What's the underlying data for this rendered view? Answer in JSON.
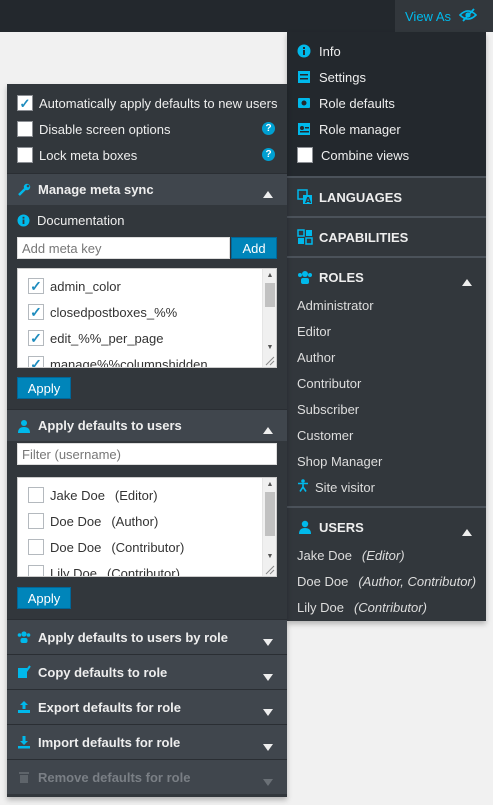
{
  "topbar": {
    "view_as": "View As"
  },
  "dropdown": {
    "items": [
      {
        "label": "Info"
      },
      {
        "label": "Settings"
      },
      {
        "label": "Role defaults"
      },
      {
        "label": "Role manager"
      },
      {
        "label": "Combine views"
      }
    ],
    "languages": "LANGUAGES",
    "capabilities": "CAPABILITIES",
    "roles_title": "ROLES",
    "roles": [
      "Administrator",
      "Editor",
      "Author",
      "Contributor",
      "Subscriber",
      "Customer",
      "Shop Manager"
    ],
    "site_visitor": "Site visitor",
    "users_title": "USERS",
    "users": [
      {
        "name": "Jake Doe",
        "role": "(Editor)"
      },
      {
        "name": "Doe Doe",
        "role": "(Author, Contributor)"
      },
      {
        "name": "Lily Doe",
        "role": "(Contributor)"
      }
    ]
  },
  "panel": {
    "options": [
      {
        "label": "Automatically apply defaults to new users",
        "checked": true
      },
      {
        "label": "Disable screen options",
        "checked": false
      },
      {
        "label": "Lock meta boxes",
        "checked": false
      }
    ],
    "meta_sync": {
      "title": "Manage meta sync",
      "documentation": "Documentation",
      "placeholder": "Add meta key",
      "add": "Add",
      "keys": [
        "admin_color",
        "closedpostboxes_%%",
        "edit_%%_per_page",
        "manage%%columnshidden"
      ],
      "apply": "Apply"
    },
    "apply_users": {
      "title": "Apply defaults to users",
      "placeholder": "Filter (username)",
      "users": [
        {
          "name": "Jake Doe",
          "role": "(Editor)"
        },
        {
          "name": "Doe Doe",
          "role": "(Author)"
        },
        {
          "name": "Doe Doe",
          "role": "(Contributor)"
        },
        {
          "name": "Lily Doe",
          "role": "(Contributor)"
        }
      ],
      "apply": "Apply"
    },
    "sections": [
      {
        "title": "Apply defaults to users by role"
      },
      {
        "title": "Copy defaults to role"
      },
      {
        "title": "Export defaults for role"
      },
      {
        "title": "Import defaults for role"
      },
      {
        "title": "Remove defaults for role"
      }
    ]
  },
  "colors": {
    "accent": "#00b9eb",
    "button": "#0085ba",
    "panel": "#32373c",
    "header": "#23282d"
  }
}
